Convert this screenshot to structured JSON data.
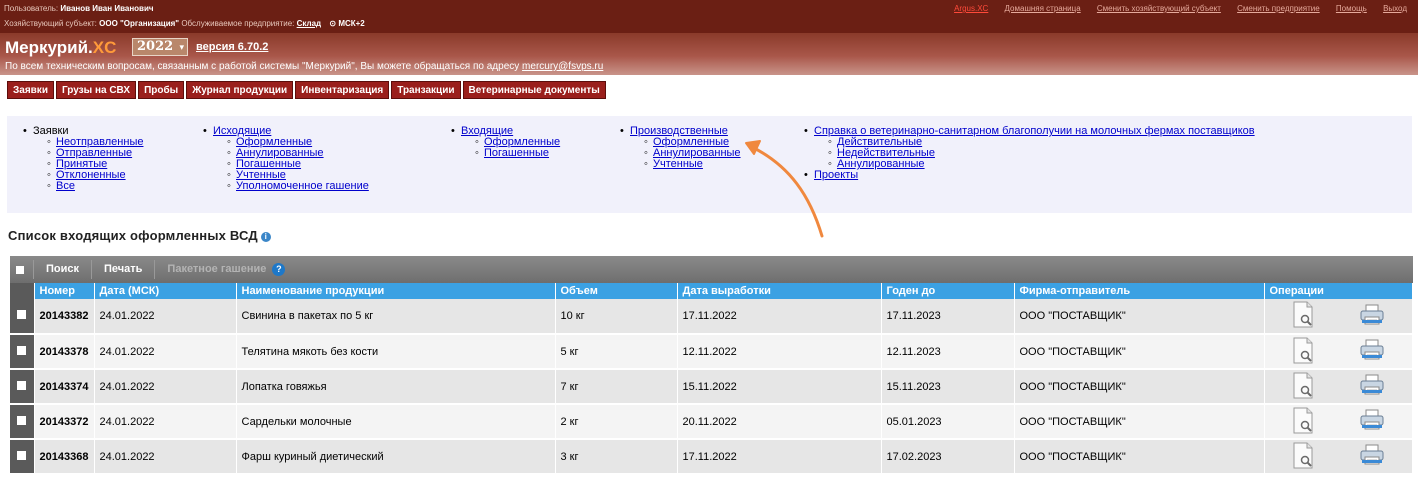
{
  "header": {
    "user_label": "Пользователь:",
    "user_name": "Иванов Иван Иванович",
    "entity_label": "Хозяйствующий субъект:",
    "entity_name": "ООО \"Организация\"",
    "enterprise_label": "Обслуживаемое предприятие:",
    "enterprise_name": "Склад",
    "timezone": "МСК+2",
    "links": [
      "Argus.XC",
      "Домашняя страница",
      "Сменить хозяйствующий субъект",
      "Сменить предприятие",
      "Помощь",
      "Выход"
    ]
  },
  "brand": {
    "name": "Меркурий.",
    "suffix": "XC",
    "year": "2022",
    "version": "версия 6.70.2",
    "support_text": "По всем техническим вопросам, связанным с работой системы \"Меркурий\", Вы можете обращаться по адресу",
    "support_email": "mercury@fsvps.ru"
  },
  "nav": {
    "tabs": [
      "Заявки",
      "Грузы на СВХ",
      "Пробы",
      "Журнал продукции",
      "Инвентаризация",
      "Транзакции",
      "Ветеринарные документы"
    ]
  },
  "submenu": {
    "requests": {
      "title": "Заявки",
      "items": [
        "Неотправленные",
        "Отправленные",
        "Принятые",
        "Отклоненные",
        "Все"
      ]
    },
    "outgoing": {
      "title": "Исходящие",
      "items": [
        "Оформленные",
        "Аннулированные",
        "Погашенные",
        "Учтенные",
        "Уполномоченное гашение"
      ]
    },
    "incoming": {
      "title": "Входящие",
      "items": [
        "Оформленные",
        "Погашенные"
      ]
    },
    "production": {
      "title": "Производственные",
      "items": [
        "Оформленные",
        "Аннулированные",
        "Учтенные"
      ]
    },
    "certificate": {
      "title": "Справка о ветеринарно-санитарном благополучии на молочных фермах поставщиков",
      "items": [
        "Действительные",
        "Недействительные",
        "Аннулированные"
      ]
    },
    "projects": "Проекты"
  },
  "list_title": "Список входящих оформленных ВСД",
  "toolbar": {
    "search": "Поиск",
    "print": "Печать",
    "batch": "Пакетное гашение"
  },
  "table": {
    "columns": [
      "Номер",
      "Дата (МСК)",
      "Наименование продукции",
      "Объем",
      "Дата выработки",
      "Годен до",
      "Фирма-отправитель",
      "Операции"
    ],
    "rows": [
      {
        "number": "20143382",
        "date": "24.01.2022",
        "product": "Свинина в пакетах по 5 кг",
        "volume": "10 кг",
        "produced": "17.11.2022",
        "expires": "17.11.2023",
        "sender": "ООО \"ПОСТАВЩИК\""
      },
      {
        "number": "20143378",
        "date": "24.01.2022",
        "product": "Телятина мякоть без кости",
        "volume": "5 кг",
        "produced": "12.11.2022",
        "expires": "12.11.2023",
        "sender": "ООО \"ПОСТАВЩИК\""
      },
      {
        "number": "20143374",
        "date": "24.01.2022",
        "product": "Лопатка говяжья",
        "volume": "7 кг",
        "produced": "15.11.2022",
        "expires": "15.11.2023",
        "sender": "ООО \"ПОСТАВЩИК\""
      },
      {
        "number": "20143372",
        "date": "24.01.2022",
        "product": "Сардельки молочные",
        "volume": "2 кг",
        "produced": "20.11.2022",
        "expires": "05.01.2023",
        "sender": "ООО \"ПОСТАВЩИК\""
      },
      {
        "number": "20143368",
        "date": "24.01.2022",
        "product": "Фарш куриный диетический",
        "volume": "3 кг",
        "produced": "17.11.2022",
        "expires": "17.02.2023",
        "sender": "ООО \"ПОСТАВЩИК\""
      }
    ]
  },
  "colors": {
    "header_bg": "#6b1f14",
    "tab_bg": "#9a1f1c",
    "table_header": "#3ba1e3",
    "annotation_arrow": "#f0883e"
  }
}
